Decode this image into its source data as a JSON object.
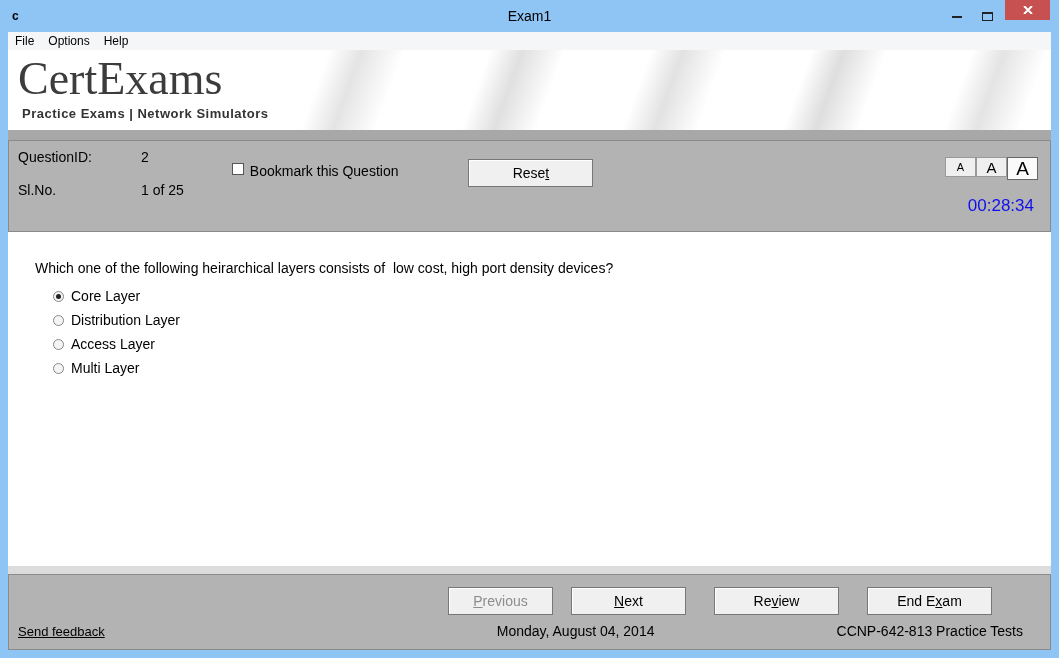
{
  "window": {
    "icon_text": "c",
    "title": "Exam1"
  },
  "menu": [
    "File",
    "Options",
    "Help"
  ],
  "banner": {
    "logo": "CertExams",
    "tagline": "Practice Exams | Network Simulators"
  },
  "header": {
    "fields": [
      {
        "label": "QuestionID:",
        "value": "2"
      },
      {
        "label": "Sl.No.",
        "value": "1 of 25"
      }
    ],
    "bookmark": {
      "label": "Bookmark this Question",
      "checked": false
    },
    "reset": {
      "text_before": "Rese",
      "access_key": "t"
    },
    "font_sizes": [
      {
        "label": "A",
        "selected": false
      },
      {
        "label": "A",
        "selected": false
      },
      {
        "label": "A",
        "selected": true
      }
    ],
    "timer": "00:28:34"
  },
  "question": {
    "text": "Which one of the following heirarchical layers consists of  low cost, high port density devices?",
    "options": [
      {
        "label": "Core Layer",
        "selected": true
      },
      {
        "label": "Distribution Layer",
        "selected": false
      },
      {
        "label": "Access Layer",
        "selected": false
      },
      {
        "label": "Multi Layer",
        "selected": false
      }
    ]
  },
  "footer": {
    "buttons": [
      {
        "access_key": "P",
        "text_after": "revious",
        "disabled": true
      },
      {
        "access_key": "N",
        "text_after": "ext",
        "disabled": false
      },
      {
        "text_before": "Re",
        "access_key": "v",
        "text_after": "iew",
        "disabled": false
      },
      {
        "text_before": "End E",
        "access_key": "x",
        "text_after": "am",
        "disabled": false
      }
    ],
    "feedback_link": "Send feedback",
    "date": "Monday, August 04, 2014",
    "product": "CCNP-642-813 Practice Tests"
  }
}
